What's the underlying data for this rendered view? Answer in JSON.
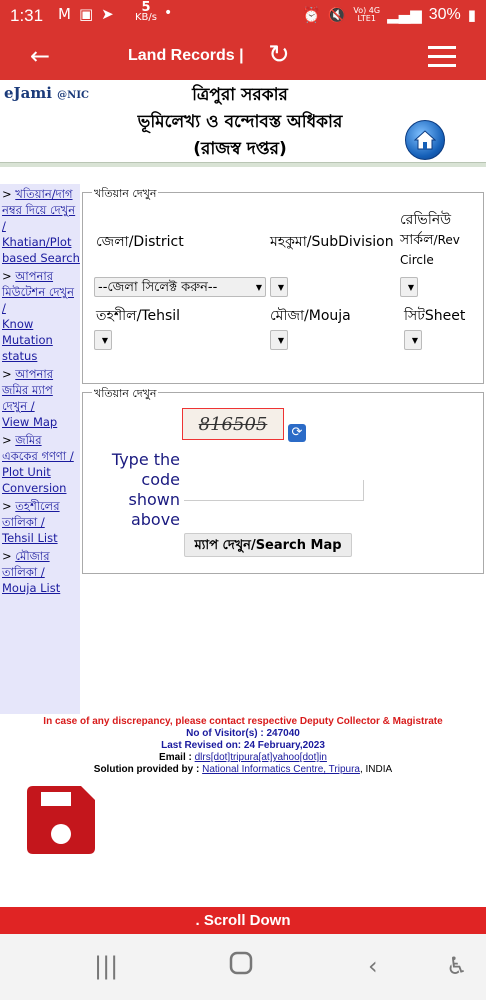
{
  "status_bar": {
    "time": "1:31",
    "speed_value": "5",
    "speed_unit": "KB/s",
    "net_label_top": "Vo) 4G",
    "net_label_bottom": "LTE1",
    "battery": "30%"
  },
  "app_bar": {
    "title": "Land Records |",
    "icons": [
      "back-arrow-icon",
      "refresh-icon",
      "hamburger-menu-icon"
    ]
  },
  "header": {
    "logo_main": "eJami",
    "logo_suffix": "@NIC",
    "line1": "ত্রিপুরা সরকার",
    "line2": "ভূমিলেখ্য ও বন্দোবস্ত অধিকার",
    "line3": "(রাজস্ব দপ্তর)"
  },
  "sidebar": {
    "items": [
      {
        "bn": "খতিয়ান/দাগ নম্বর দিয়ে দেখুন /",
        "en": "Khatian/Plot based Search"
      },
      {
        "bn": "আপনার মিউটেশন দেখুন /",
        "en": "Know Mutation status"
      },
      {
        "bn": "আপনার জমির ম্যাপ দেখুন /",
        "en": "View Map"
      },
      {
        "bn": "জমির এককের গণণা /",
        "en": "Plot Unit Conversion"
      },
      {
        "bn": "তহশীলের তালিকা /",
        "en": "Tehsil List"
      },
      {
        "bn": "মৌজার তালিকা /",
        "en": "Mouja List"
      }
    ]
  },
  "form1": {
    "legend": "খতিয়ান দেখুন",
    "district_label": "জেলা/District",
    "subdivision_label": "মহকুমা/SubDivision",
    "rev_circle_label_bn": "রেভিনিউ সার্কল",
    "rev_circle_label_en": "/Rev Circle",
    "district_select": "--জেলা সিলেক্ট করুন--",
    "tehsil_label": "তহশীল/Tehsil",
    "mouja_label": "মৌজা/Mouja",
    "sheet_label_bn": "সিট",
    "sheet_label_en": "Sheet"
  },
  "form2": {
    "legend": "খতিয়ান দেখুন",
    "captcha": "816505",
    "type_code_label": "Type the code shown above",
    "search_button": "ম্যাপ দেখুন/Search Map"
  },
  "footer": {
    "discrepancy": "In case of any discrepancy, please contact  respective Deputy Collector & Magistrate",
    "visitors": "No of Visitor(s) : 247040",
    "revised": "Last Revised on: 24 February,2023",
    "email_label": "Email :",
    "email": "dlrs[dot]tripura[at]yahoo[dot]in",
    "solution_label": "Solution provided by :",
    "solution_link": "National Informatics Centre, Tripura",
    "country": ", INDIA"
  },
  "scroll_bar": {
    "text": ". Scroll Down"
  },
  "colors": {
    "primary_red": "#d9342f",
    "link_blue": "#1a1a9e",
    "sidebar_bg": "#e6e6fa",
    "save_icon": "#c4161c"
  }
}
